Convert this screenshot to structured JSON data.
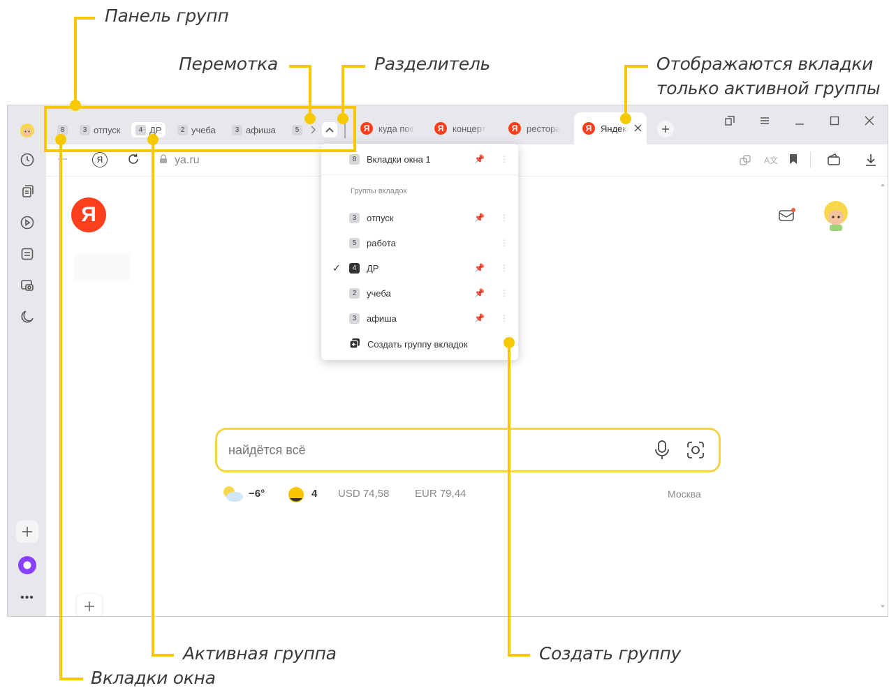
{
  "annotations": {
    "groups_panel": "Панель групп",
    "scroll": "Перемотка",
    "divider": "Разделитель",
    "active_group_tabs_line1": "Отображаются вкладки",
    "active_group_tabs_line2": "только активной группы",
    "active_group": "Активная группа",
    "window_tabs": "Вкладки окна",
    "create_group": "Создать группу"
  },
  "tab_groups": [
    {
      "count": "8",
      "label": ""
    },
    {
      "count": "3",
      "label": "отпуск"
    },
    {
      "count": "4",
      "label": "ДР"
    },
    {
      "count": "2",
      "label": "учеба"
    },
    {
      "count": "3",
      "label": "афиша"
    },
    {
      "count": "5",
      "label": ""
    }
  ],
  "tabs": [
    {
      "title": "куда пое"
    },
    {
      "title": "концерт"
    },
    {
      "title": "рестора"
    },
    {
      "title": "Яндекс"
    }
  ],
  "address": {
    "url": "ya.ru"
  },
  "menu": {
    "window_tabs": {
      "count": "8",
      "label": "Вкладки окна 1"
    },
    "section_title": "Группы вкладок",
    "groups": [
      {
        "count": "3",
        "label": "отпуск"
      },
      {
        "count": "5",
        "label": "работа"
      },
      {
        "count": "4",
        "label": "ДР"
      },
      {
        "count": "2",
        "label": "учеба"
      },
      {
        "count": "3",
        "label": "афиша"
      }
    ],
    "create": "Создать группу вкладок"
  },
  "logo": "Я",
  "search": {
    "placeholder": "найдётся всё"
  },
  "info": {
    "temperature": "−6°",
    "traffic": "4",
    "usd": "USD 74,58",
    "eur": "EUR 79,44",
    "city": "Москва"
  },
  "colors": {
    "accent": "#f6c800",
    "brand": "#fc3f1d",
    "alice": "#8a3ffc"
  }
}
